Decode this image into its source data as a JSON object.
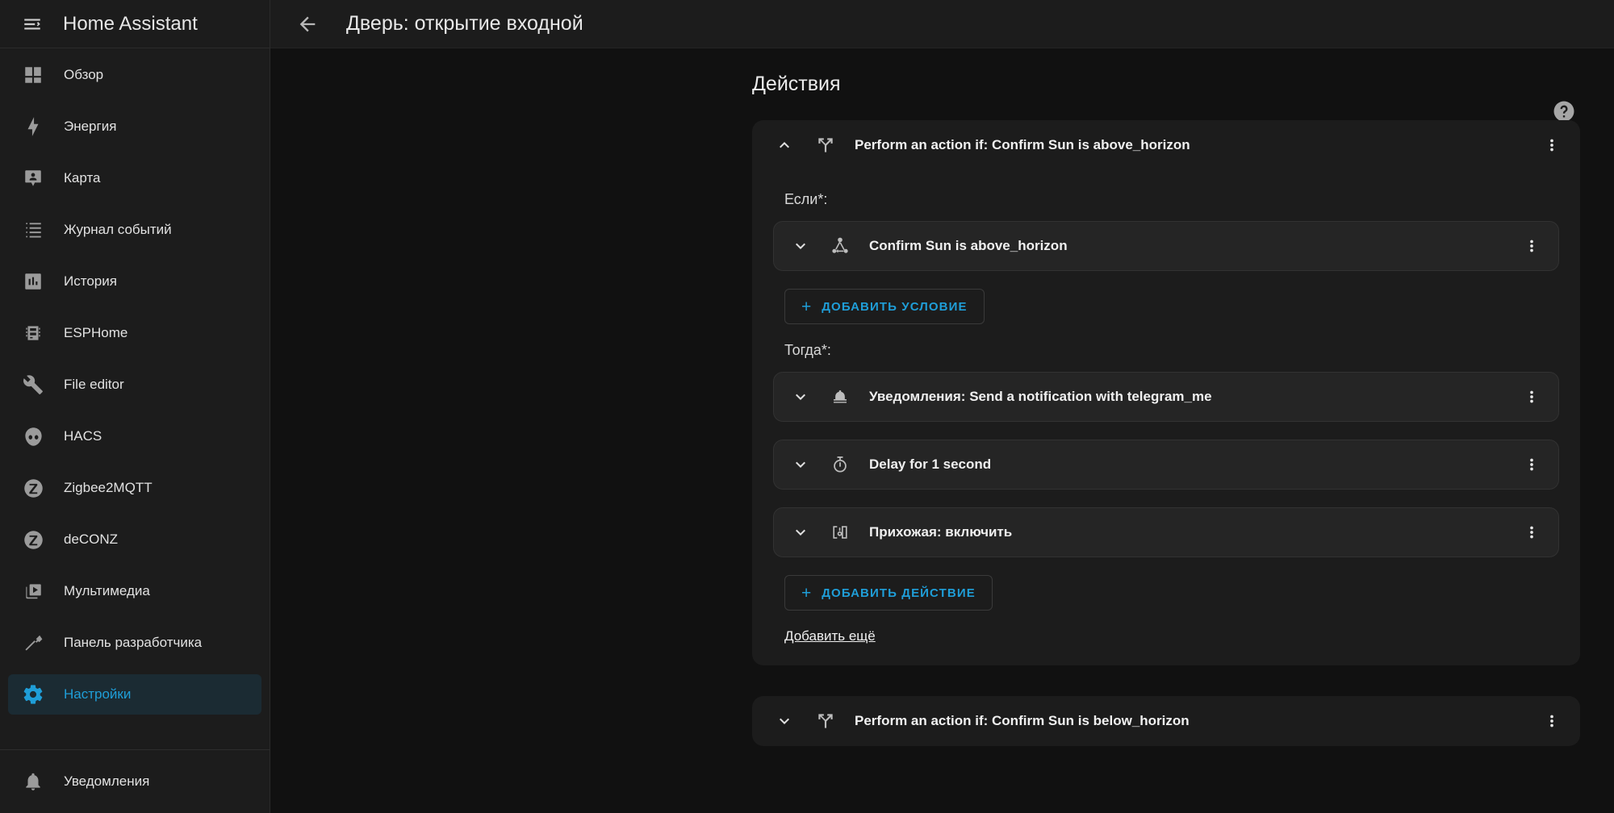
{
  "sidebar": {
    "title": "Home Assistant",
    "menu_icon": "menu-collapse-icon",
    "items": [
      {
        "label": "Обзор",
        "icon": "view-dashboard-icon",
        "active": false
      },
      {
        "label": "Энергия",
        "icon": "lightning-bolt-icon",
        "active": false
      },
      {
        "label": "Карта",
        "icon": "map-marker-account-icon",
        "active": false
      },
      {
        "label": "Журнал событий",
        "icon": "format-list-bulleted-icon",
        "active": false
      },
      {
        "label": "История",
        "icon": "chart-box-icon",
        "active": false
      },
      {
        "label": "ESPHome",
        "icon": "chip-icon",
        "active": false
      },
      {
        "label": "File editor",
        "icon": "wrench-icon",
        "active": false
      },
      {
        "label": "HACS",
        "icon": "alien-icon",
        "active": false
      },
      {
        "label": "Zigbee2MQTT",
        "icon": "zigbee-icon",
        "active": false
      },
      {
        "label": "deCONZ",
        "icon": "zigbee-icon",
        "active": false
      },
      {
        "label": "Мультимедиа",
        "icon": "play-box-multiple-icon",
        "active": false
      },
      {
        "label": "Панель разработчика",
        "icon": "hammer-icon",
        "active": false
      },
      {
        "label": "Настройки",
        "icon": "cog-icon",
        "active": true
      }
    ],
    "bottom_items": [
      {
        "label": "Уведомления",
        "icon": "bell-icon"
      }
    ]
  },
  "topbar": {
    "back_icon": "arrow-left-icon",
    "title": "Дверь: открытие входной"
  },
  "section": {
    "title": "Действия",
    "help_icon": "help-circle-icon"
  },
  "cards": [
    {
      "icon": "call-split-icon",
      "title": "Perform an action if: Confirm Sun is above_horizon",
      "expanded": true,
      "chevron": "chevron-up-icon",
      "menu_icon": "dots-vertical-icon",
      "if_label": "Если*:",
      "conditions": [
        {
          "icon": "state-machine-icon",
          "title": "Confirm Sun is above_horizon",
          "chevron": "chevron-down-icon",
          "menu_icon": "dots-vertical-icon"
        }
      ],
      "add_condition_label": "ДОБАВИТЬ УСЛОВИЕ",
      "then_label": "Тогда*:",
      "actions": [
        {
          "icon": "bell-icon",
          "title": "Уведомления: Send a notification with telegram_me",
          "chevron": "chevron-down-icon",
          "menu_icon": "dots-vertical-icon"
        },
        {
          "icon": "timer-icon",
          "title": "Delay for 1 second",
          "chevron": "chevron-down-icon",
          "menu_icon": "dots-vertical-icon"
        },
        {
          "icon": "device-toggle-icon",
          "title": "Прихожая: включить",
          "chevron": "chevron-down-icon",
          "menu_icon": "dots-vertical-icon"
        }
      ],
      "add_action_label": "ДОБАВИТЬ ДЕЙСТВИЕ",
      "add_more_label": "Добавить ещё"
    },
    {
      "icon": "call-split-icon",
      "title": "Perform an action if: Confirm Sun is below_horizon",
      "expanded": false,
      "chevron": "chevron-down-icon",
      "menu_icon": "dots-vertical-icon"
    }
  ],
  "colors": {
    "accent": "#1f9ed8",
    "sidebar_bg": "#1c1c1c",
    "content_bg": "#111111",
    "card_bg": "#1c1c1c",
    "row_bg": "#252525",
    "active_item_bg": "#1b2b33",
    "text_primary": "#f0f0f0",
    "text_secondary": "#9b9b9b"
  }
}
